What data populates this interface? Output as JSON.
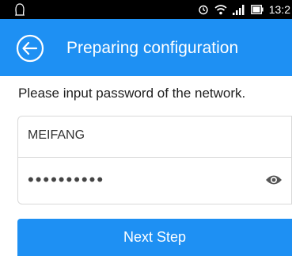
{
  "status_bar": {
    "time": "13:2",
    "icons": [
      "notification-icon",
      "alarm-icon",
      "wifi-icon",
      "signal-icon",
      "battery-icon"
    ]
  },
  "app_bar": {
    "title": "Preparing configuration",
    "back_icon": "back-arrow-circle-icon",
    "color": "#1e90f3"
  },
  "form": {
    "prompt": "Please input password of the network.",
    "ssid_value": "MEIFANG",
    "password_masked": "••••••••••",
    "password_toggle_icon": "eye-icon",
    "submit_label": "Next Step"
  }
}
